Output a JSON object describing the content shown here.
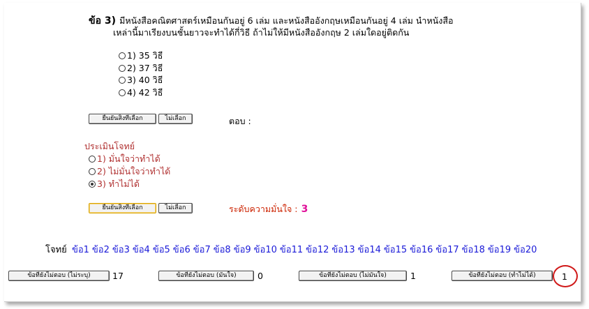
{
  "question": {
    "number_label": "ข้อ 3)",
    "line1": "มีหนังสือคณิตศาสตร์เหมือนกันอยู่ 6 เล่ม และหนังสืออังกฤษเหมือนกันอยู่ 4 เล่ม นำหนังสือ",
    "line2": "เหล่านี้มาเรียงบนชั้นยาวจะทำได้กี่วิธี ถ้าไม่ให้มีหนังสืออังกฤษ 2 เล่มใดอยู่ติดกัน",
    "options": [
      "1) 35 วิธี",
      "2) 37 วิธี",
      "3) 40 วิธี",
      "4) 42 วิธี"
    ]
  },
  "answer_controls": {
    "confirm_label": "ยืนยันสิ่งที่เลือก",
    "cancel_label": "ไม่เลือก",
    "answer_label": "ตอบ :"
  },
  "evaluation": {
    "title": "ประเมินโจทย์",
    "options": [
      "1) มั่นใจว่าทำได้",
      "2) ไม่มั่นใจว่าทำได้",
      "3) ทำไม่ได้"
    ],
    "selected_index": 2,
    "confirm_label": "ยืนยันสิ่งที่เลือก",
    "cancel_label": "ไม่เลือก",
    "confidence_label": "ระดับความมั่นใจ :",
    "confidence_value": "3"
  },
  "navigation": {
    "label": "โจทย์",
    "items": [
      "ข้อ1",
      "ข้อ2",
      "ข้อ3",
      "ข้อ4",
      "ข้อ5",
      "ข้อ6",
      "ข้อ7",
      "ข้อ8",
      "ข้อ9",
      "ข้อ10",
      "ข้อ11",
      "ข้อ12",
      "ข้อ13",
      "ข้อ14",
      "ข้อ15",
      "ข้อ16",
      "ข้อ17",
      "ข้อ18",
      "ข้อ19",
      "ข้อ20"
    ]
  },
  "summary": [
    {
      "label": "ข้อที่ยังไม่ตอบ (ไม่ระบุ)",
      "count": "17"
    },
    {
      "label": "ข้อที่ยังไม่ตอบ (มั่นใจ)",
      "count": "0"
    },
    {
      "label": "ข้อที่ยังไม่ตอบ (ไม่มั่นใจ)",
      "count": "1"
    },
    {
      "label": "ข้อที่ยังไม่ตอบ (ทำไม่ได้)",
      "count": "1"
    }
  ],
  "colors": {
    "nav_link": "#1a1ad8",
    "evaluation_text": "#b03030",
    "confidence_value": "#e0119a",
    "highlight_circle": "#d01818"
  }
}
